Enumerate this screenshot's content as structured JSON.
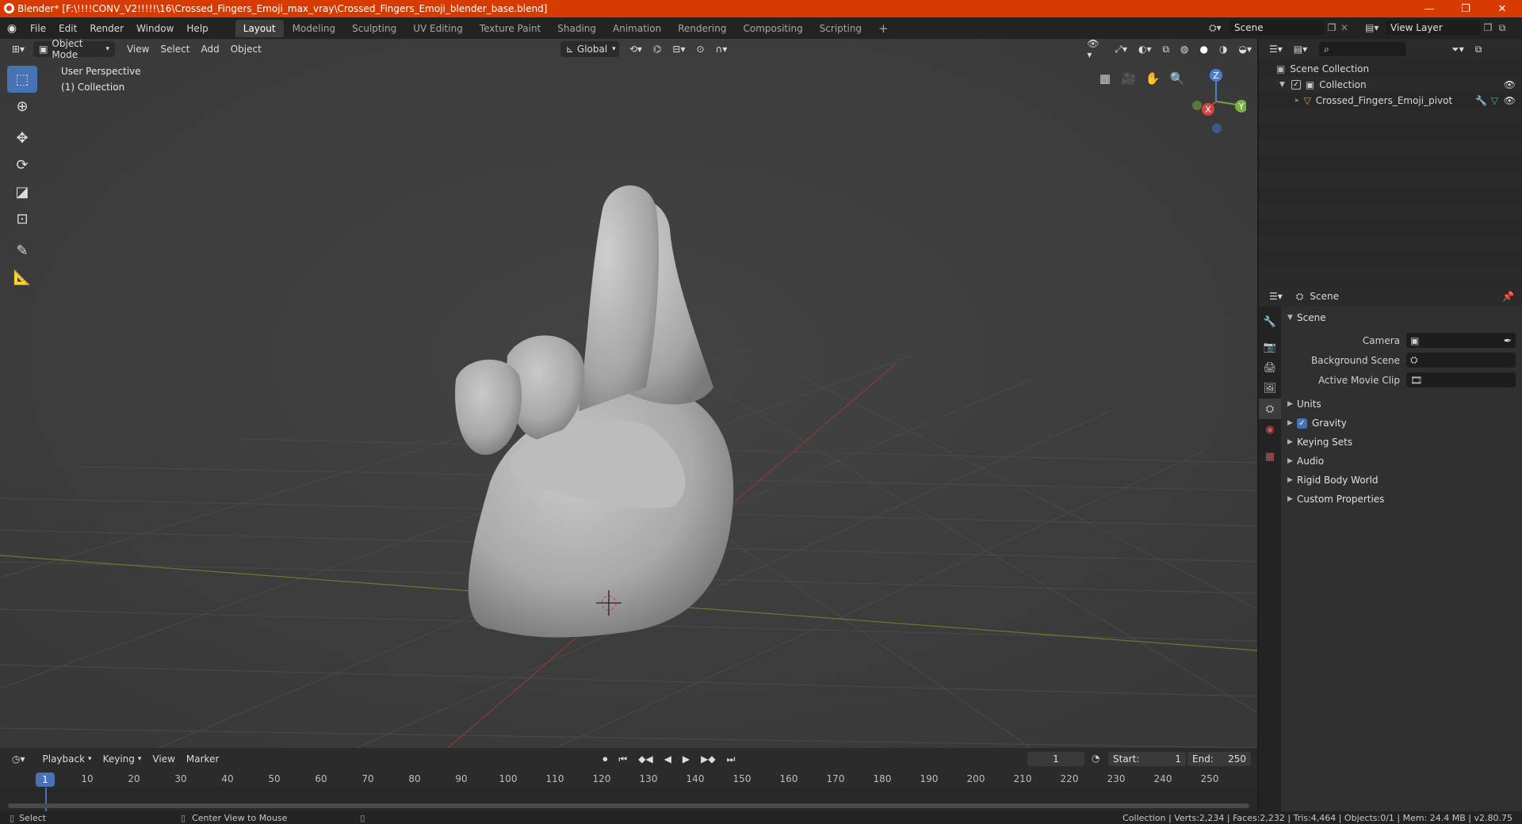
{
  "window": {
    "title": "Blender* [F:\\!!!!CONV_V2!!!!!\\16\\Crossed_Fingers_Emoji_max_vray\\Crossed_Fingers_Emoji_blender_base.blend]",
    "minimize": "—",
    "maximize": "❐",
    "close": "✕"
  },
  "menu": {
    "file": "File",
    "edit": "Edit",
    "render": "Render",
    "window": "Window",
    "help": "Help"
  },
  "workspaces": [
    "Layout",
    "Modeling",
    "Sculpting",
    "UV Editing",
    "Texture Paint",
    "Shading",
    "Animation",
    "Rendering",
    "Compositing",
    "Scripting"
  ],
  "topright": {
    "scene": "Scene",
    "view_layer": "View Layer"
  },
  "viewport": {
    "mode": "Object Mode",
    "menus": [
      "View",
      "Select",
      "Add",
      "Object"
    ],
    "orientation": "Global",
    "perspective_label": "User Perspective",
    "collection_label": "(1) Collection",
    "gizmo": {
      "z": "Z",
      "x": "X",
      "y": "Y"
    }
  },
  "timeline": {
    "menus": [
      "Playback",
      "Keying",
      "View",
      "Marker"
    ],
    "current_frame": "1",
    "start_label": "Start:",
    "start_value": "1",
    "end_label": "End:",
    "end_value": "250",
    "ticks": [
      "10",
      "20",
      "30",
      "40",
      "50",
      "60",
      "70",
      "80",
      "90",
      "100",
      "110",
      "120",
      "130",
      "140",
      "150",
      "160",
      "170",
      "180",
      "190",
      "200",
      "210",
      "220",
      "230",
      "240",
      "250"
    ]
  },
  "outliner": {
    "scene_collection": "Scene Collection",
    "collection": "Collection",
    "object": "Crossed_Fingers_Emoji_pivot"
  },
  "properties": {
    "header_title": "Scene",
    "panel_scene": "Scene",
    "camera_label": "Camera",
    "background_scene_label": "Background Scene",
    "active_movie_clip_label": "Active Movie Clip",
    "units": "Units",
    "gravity": "Gravity",
    "keying_sets": "Keying Sets",
    "audio": "Audio",
    "rigid_body_world": "Rigid Body World",
    "custom_properties": "Custom Properties"
  },
  "statusbar": {
    "select": "Select",
    "center_view": "Center View to Mouse",
    "stats": "Collection | Verts:2,234 | Faces:2,232 | Tris:4,464 | Objects:0/1 | Mem: 24.4 MB | v2.80.75"
  }
}
